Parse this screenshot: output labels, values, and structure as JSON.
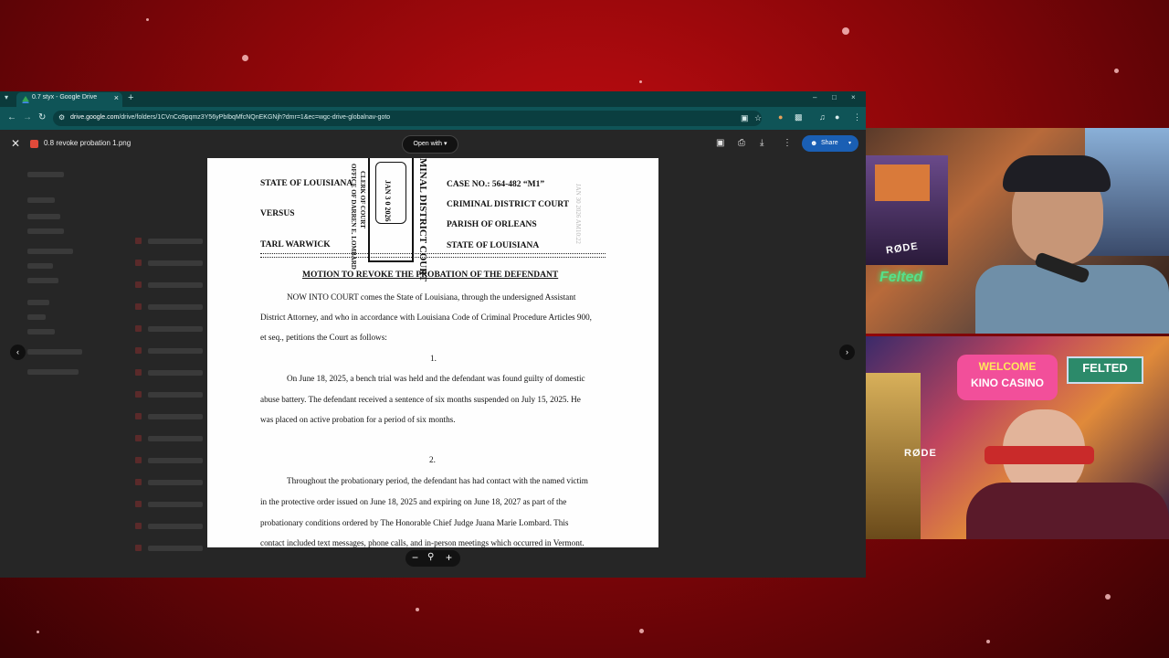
{
  "browser": {
    "tab_title": "0.7 styx - Google Drive",
    "url_domain": "drive.google.com",
    "url_path": "/drive/folders/1CVnCo9pqmz3Y56yPbIbqMfcNQnEKGNjh?dmr=1&ec=wgc-drive-globalnav-goto"
  },
  "preview": {
    "filename": "0.8 revoke probation 1.png",
    "open_with_label": "Open with",
    "share_label": "Share"
  },
  "document": {
    "left_caption": [
      "STATE OF LOUISIANA",
      "VERSUS",
      "TARL WARWICK"
    ],
    "right_caption": [
      "CASE NO.: 564-482 “M1”",
      "CRIMINAL DISTRICT COURT",
      "PARISH OF ORLEANS",
      "STATE OF LOUISIANA"
    ],
    "stamp_clerk": [
      "OFFICE OF DARREN E. LOMBARD",
      "CLERK OF COURT"
    ],
    "stamp_date": "JAN 3 0 2026",
    "stamp_court": "MINAL DISTRICT COURT",
    "faint_stamp": "JAN 30 2026 AM10:22",
    "heading": "MOTION TO REVOKE THE PROBATION OF THE DEFENDANT",
    "intro_lines": [
      "NOW INTO COURT comes the State of Louisiana, through the undersigned Assistant",
      "District Attorney, and who in accordance with Louisiana Code of Criminal Procedure Articles 900,",
      "et seq., petitions the Court as follows:"
    ],
    "section1_number": "1.",
    "section1_lines": [
      "On June 18, 2025, a bench trial was held and the defendant was found guilty of domestic",
      "abuse battery. The defendant received a sentence of six months suspended on July 15, 2025. He",
      "was placed on active probation for a period of six months."
    ],
    "section2_number": "2.",
    "section2_lines": [
      "Throughout the probationary period, the defendant has had contact with the named victim",
      "in the protective order issued on June 18, 2025 and expiring on June 18, 2027 as part of the",
      "probationary conditions ordered by The Honorable Chief Judge Juana Marie Lombard. This",
      "contact included text messages, phone calls, and in-person meetings which occurred in Vermont."
    ]
  },
  "webcams": {
    "top_mic_brand": "RØDE",
    "bottom_mic_brand": "RØDE",
    "sign_welcome": "WELCOME",
    "sign_casino": "KINO CASINO",
    "sign_felted": "FELTED"
  },
  "icons": [
    "tab-menu-icon",
    "favicon-drive-icon",
    "close-icon",
    "new-tab-icon",
    "back-arrow-icon",
    "forward-arrow-icon",
    "reload-icon",
    "site-info-icon",
    "bookmark-star-icon",
    "comment-add-icon",
    "print-icon",
    "download-icon",
    "more-vert-icon",
    "person-add-icon",
    "chevron-left-icon",
    "chevron-right-icon",
    "zoom-out-icon",
    "zoom-icon",
    "zoom-in-icon"
  ]
}
